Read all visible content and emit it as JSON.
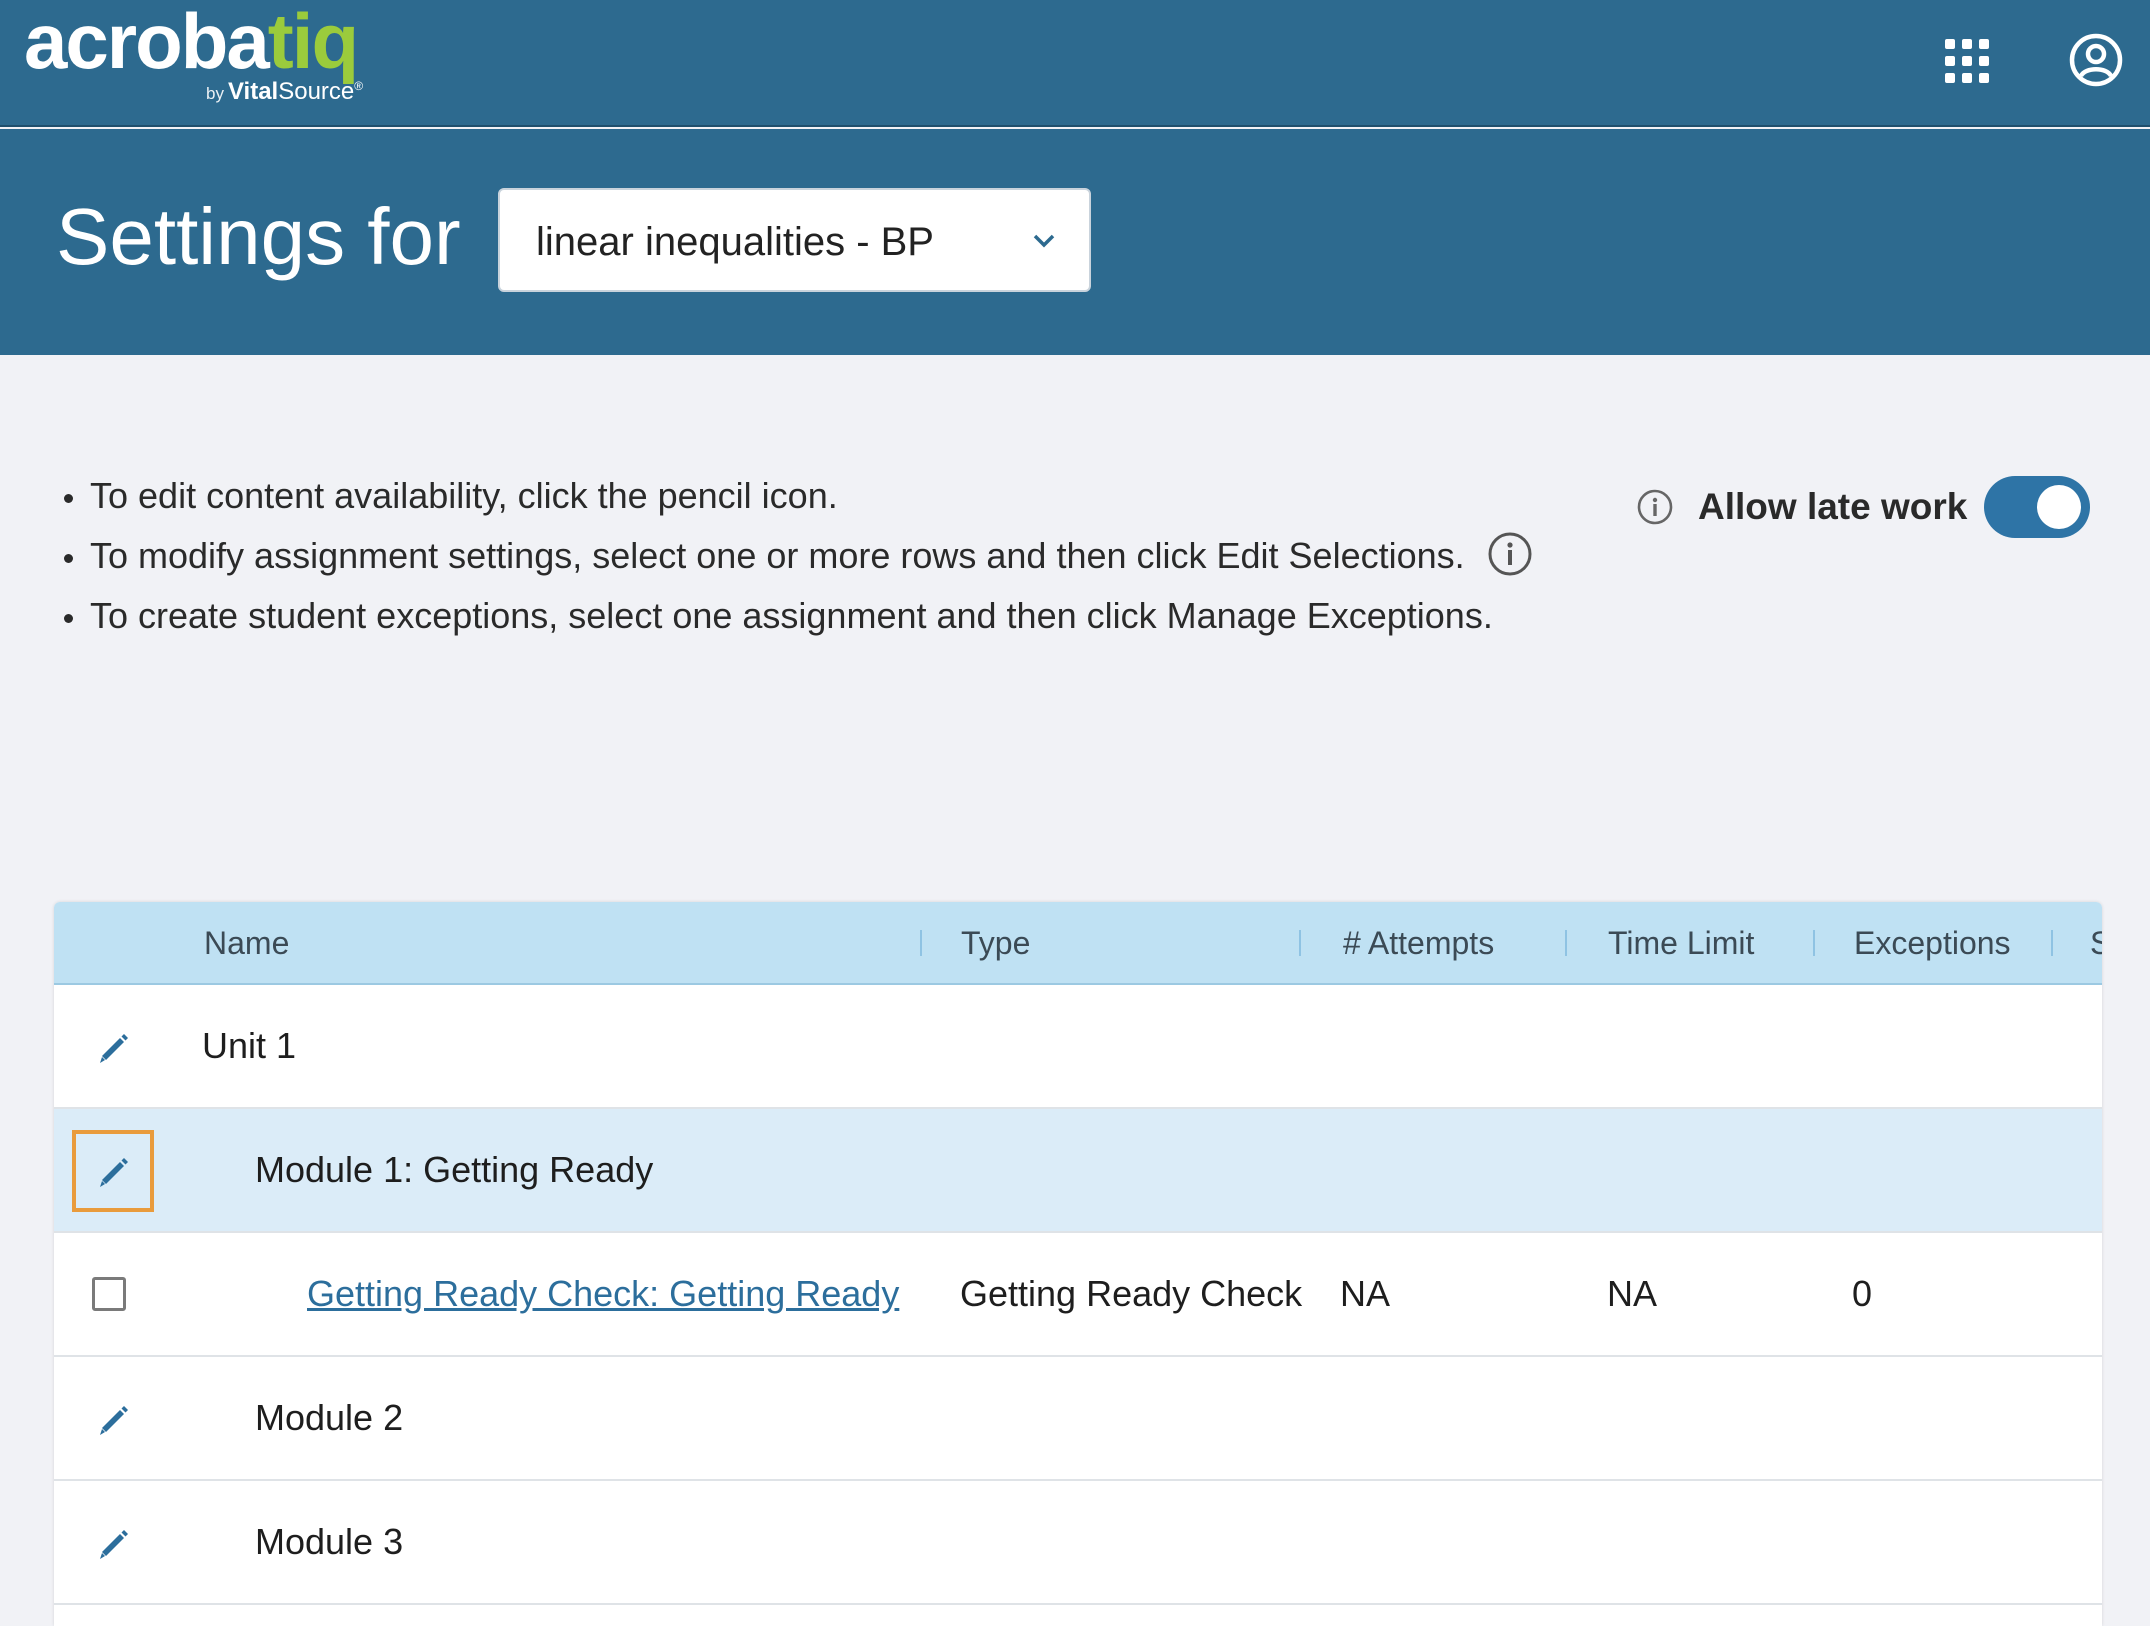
{
  "topbar": {
    "logo_main": "acroba",
    "logo_accent": "tiq",
    "logo_by": "by",
    "logo_vital": "Vital",
    "logo_source": "Source",
    "logo_tm": "®",
    "apps_icon": "apps-grid-icon",
    "account_icon": "account-circle-icon"
  },
  "header": {
    "title": "Settings for",
    "course_select": {
      "value": "linear inequalities - BP",
      "icon": "chevron-down-icon"
    }
  },
  "instructions": [
    "To edit content availability, click the pencil icon.",
    "To modify assignment settings, select one or more rows and then click Edit Selections.",
    "To create student exceptions, select one assignment and then click Manage Exceptions."
  ],
  "late_work": {
    "label": "Allow late work",
    "enabled": true
  },
  "table": {
    "columns": [
      "Name",
      "Type",
      "# Attempts",
      "Time Limit",
      "Exceptions",
      "S"
    ],
    "rows": [
      {
        "kind": "unit",
        "name": "Unit 1",
        "type": "",
        "attempts": "",
        "time_limit": "",
        "exceptions": ""
      },
      {
        "kind": "module",
        "name": "Module 1: Getting Ready",
        "type": "",
        "attempts": "",
        "time_limit": "",
        "exceptions": "",
        "selected": true
      },
      {
        "kind": "assignment",
        "name": "Getting Ready Check: Getting Ready",
        "type": "Getting Ready Check",
        "attempts": "NA",
        "time_limit": "NA",
        "exceptions": "0"
      },
      {
        "kind": "module",
        "name": "Module 2",
        "type": "",
        "attempts": "",
        "time_limit": "",
        "exceptions": ""
      },
      {
        "kind": "module",
        "name": "Module 3",
        "type": "",
        "attempts": "",
        "time_limit": "",
        "exceptions": ""
      }
    ]
  },
  "colors": {
    "brand_blue": "#2d6a8f",
    "logo_green": "#9bcb3c",
    "header_row": "#bfe1f3",
    "selected_row": "#dbecf8",
    "focus_outline": "#e99b3c",
    "toggle_on": "#2e74a6",
    "link": "#2c6e9c"
  }
}
